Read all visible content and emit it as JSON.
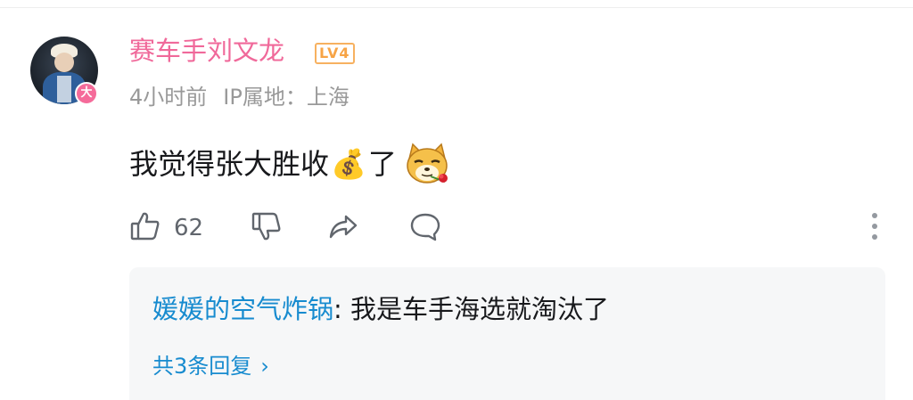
{
  "comment": {
    "author": {
      "name": "赛车手刘文龙",
      "level": "LV4",
      "avatar_badge": "大"
    },
    "meta": {
      "time": "4小时前",
      "ip_location": "IP属地：上海"
    },
    "content": {
      "text_before_emoji": "我觉得张大胜收",
      "emoji_money": "💰",
      "text_after_emoji": "了",
      "sticker": "dog-with-rose-sticker"
    },
    "actions": {
      "like_count": "62"
    },
    "replies": {
      "preview_user": "媛媛的空气炸锅",
      "preview_separator": ": ",
      "preview_text": "我是车手海选就淘汰了",
      "view_all_label": "共3条回复",
      "chevron": "›"
    }
  },
  "colors": {
    "username_pink": "#f0699a",
    "level_orange": "#f7a446",
    "link_blue": "#178bcf",
    "meta_gray": "#999999",
    "reply_bg": "#f6f7f8"
  }
}
